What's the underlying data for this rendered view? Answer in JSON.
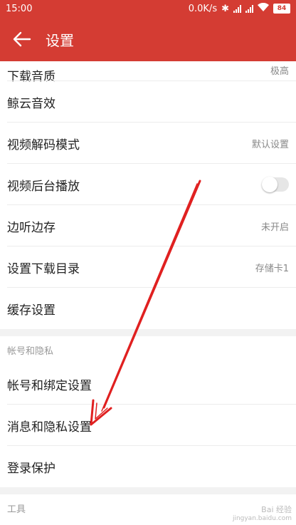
{
  "status_bar": {
    "time": "15:00",
    "speed": "0.0K/s",
    "battery": "84",
    "icons": [
      "bluetooth-icon",
      "signal-icon",
      "wifi-icon",
      "battery-icon"
    ]
  },
  "app_bar": {
    "title": "设置",
    "back_icon": "arrow-left-icon"
  },
  "items_top": [
    {
      "label": "下载音质",
      "value": "极高"
    },
    {
      "label": "鲸云音效",
      "value": ""
    },
    {
      "label": "视频解码模式",
      "value": "默认设置"
    },
    {
      "label": "视频后台播放",
      "toggle": false
    },
    {
      "label": "边听边存",
      "value": "未开启"
    },
    {
      "label": "设置下载目录",
      "value": "存储卡1"
    },
    {
      "label": "缓存设置",
      "value": ""
    }
  ],
  "section_account": {
    "title": "帐号和隐私",
    "items": [
      {
        "label": "帐号和绑定设置"
      },
      {
        "label": "消息和隐私设置"
      },
      {
        "label": "登录保护"
      }
    ]
  },
  "section_tools": {
    "title": "工具"
  },
  "watermark": {
    "text": "Bai 经验",
    "sub": "jingyan.baidu.com"
  },
  "colors": {
    "accent": "#d43c33",
    "annotation": "#e02020"
  }
}
